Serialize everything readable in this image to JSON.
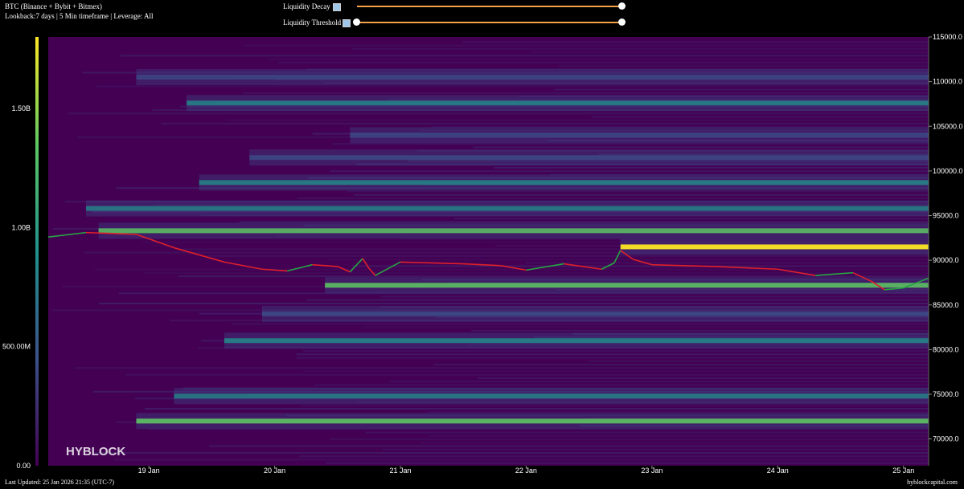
{
  "header": {
    "title": "BTC (Binance + Bybit + Bitmex)",
    "subtitle": "Lookback:7 days | 5 Min timeframe | Leverage: All"
  },
  "controls": {
    "decay_label": "Liquidity Decay",
    "threshold_label": "Liquidity Threshold"
  },
  "footer": {
    "updated": "Last Updated: 25 Jan 2026 21:35 (UTC-7)",
    "site": "hyblockcapital.com"
  },
  "watermark": "HYBLOCK",
  "colors": {
    "background": "#440154",
    "low": "#3b528b",
    "mid": "#21918c",
    "high": "#5ec962",
    "max": "#fde725",
    "price_up": "#26a641",
    "price_down": "#e0202a"
  },
  "chart_data": {
    "type": "heatmap",
    "x_ticks": [
      "19 Jan",
      "20 Jan",
      "21 Jan",
      "22 Jan",
      "23 Jan",
      "24 Jan",
      "25 Jan"
    ],
    "x_tick_days": [
      19,
      20,
      21,
      22,
      23,
      24,
      25
    ],
    "xlim_days": [
      18.2,
      25.2
    ],
    "y_ticks": [
      "70000.0",
      "75000.0",
      "80000.0",
      "85000.0",
      "90000.0",
      "95000.0",
      "100000.0",
      "105000.0",
      "110000.0",
      "115000.0"
    ],
    "y_tick_values": [
      70000,
      75000,
      80000,
      85000,
      90000,
      95000,
      100000,
      105000,
      110000,
      115000
    ],
    "ylim": [
      67000,
      115000
    ],
    "colorbar": {
      "ticks": [
        "0.00",
        "500.00M",
        "1.00B",
        "1.50B"
      ],
      "tick_values": [
        0,
        500000000,
        1000000000,
        1500000000
      ],
      "range": [
        0,
        1800000000
      ]
    },
    "liquidity_bands": [
      {
        "price": 72000,
        "intensity": 0.8,
        "start_day": 18.9
      },
      {
        "price": 74800,
        "intensity": 0.45,
        "start_day": 19.2
      },
      {
        "price": 81000,
        "intensity": 0.6,
        "start_day": 19.6
      },
      {
        "price": 84000,
        "intensity": 0.35,
        "start_day": 19.9
      },
      {
        "price": 87200,
        "intensity": 0.75,
        "start_day": 20.4
      },
      {
        "price": 91500,
        "intensity": 1.0,
        "start_day": 22.75
      },
      {
        "price": 93300,
        "intensity": 0.7,
        "start_day": 18.6
      },
      {
        "price": 95800,
        "intensity": 0.45,
        "start_day": 18.5
      },
      {
        "price": 98700,
        "intensity": 0.6,
        "start_day": 19.4
      },
      {
        "price": 101500,
        "intensity": 0.35,
        "start_day": 19.8
      },
      {
        "price": 104000,
        "intensity": 0.3,
        "start_day": 20.6
      },
      {
        "price": 107600,
        "intensity": 0.55,
        "start_day": 19.3
      },
      {
        "price": 110500,
        "intensity": 0.3,
        "start_day": 18.9
      }
    ],
    "price_series": {
      "x": [
        18.2,
        18.5,
        18.9,
        19.2,
        19.4,
        19.6,
        19.9,
        20.1,
        20.3,
        20.5,
        20.6,
        20.7,
        20.75,
        20.8,
        21.0,
        21.5,
        21.8,
        22.0,
        22.3,
        22.6,
        22.7,
        22.75,
        22.85,
        23.0,
        23.5,
        24.0,
        24.3,
        24.6,
        24.75,
        24.85,
        25.0,
        25.2
      ],
      "y": [
        92600,
        93100,
        92900,
        91400,
        90600,
        89800,
        89000,
        88800,
        89500,
        89300,
        88700,
        90200,
        89100,
        88300,
        89800,
        89600,
        89400,
        88900,
        89600,
        89000,
        89700,
        91100,
        90100,
        89500,
        89300,
        89000,
        88300,
        88600,
        87600,
        86700,
        86900,
        88000
      ]
    }
  }
}
